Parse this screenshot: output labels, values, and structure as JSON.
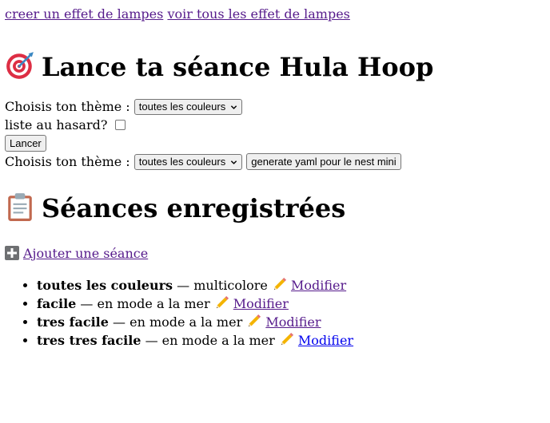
{
  "top_links": {
    "create": "creer un effet de lampes",
    "view_all": "voir tous les effet de lampes"
  },
  "launch": {
    "icon": "direct-hit-target-icon",
    "title": "Lance ta séance Hula Hoop",
    "theme_label_1": "Choisis ton thème :",
    "theme_select_1": "toutes les couleurs",
    "random_label": "liste au hasard?",
    "random_checked": false,
    "launch_button": "Lancer",
    "theme_label_2": "Choisis ton thème :",
    "theme_select_2": "toutes les couleurs",
    "yaml_button": "generate yaml pour le nest mini"
  },
  "saved": {
    "icon": "clipboard-icon",
    "title": "Séances enregistrées",
    "add_icon": "plus-icon",
    "add_link": "Ajouter une séance",
    "edit_icon": "pencil-icon",
    "items": [
      {
        "name": "toutes les couleurs",
        "separator": "—",
        "mode": "multicolore",
        "edit": "Modifier",
        "visited": true
      },
      {
        "name": "facile",
        "separator": "—",
        "mode": "en mode a la mer",
        "edit": "Modifier",
        "visited": true
      },
      {
        "name": "tres facile",
        "separator": "—",
        "mode": "en mode a la mer",
        "edit": "Modifier",
        "visited": true
      },
      {
        "name": "tres tres facile",
        "separator": "—",
        "mode": "en mode a la mer",
        "edit": "Modifier",
        "visited": false
      }
    ]
  },
  "colors": {
    "visited_link": "#551a8b",
    "unvisited_link": "#0000ee",
    "control_bg": "#efefef",
    "control_border": "#767676"
  }
}
